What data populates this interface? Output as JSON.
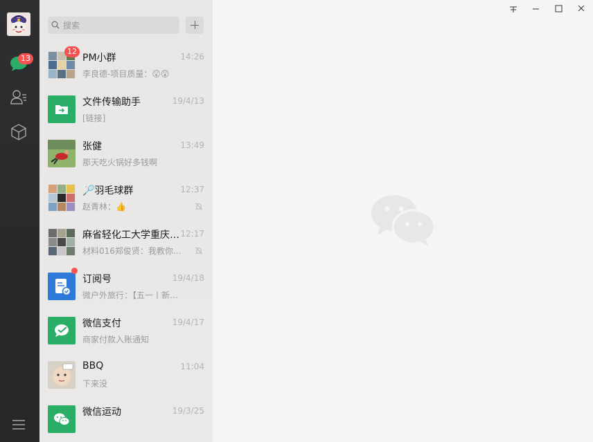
{
  "window": {
    "title": "WeChat"
  },
  "sidebar": {
    "chats_badge": "13",
    "icons": [
      "chat-icon",
      "contacts-icon",
      "mini-programs-icon",
      "menu-icon"
    ],
    "accent_color": "#2aae67"
  },
  "search": {
    "placeholder": "搜索"
  },
  "chats": [
    {
      "name": "PM小群",
      "preview": "李良德-项目质量：😲😲",
      "time": "14:26",
      "badge": "12"
    },
    {
      "name": "文件传输助手",
      "preview": "[链接]",
      "time": "19/4/13"
    },
    {
      "name": "张健",
      "preview": "那天吃火锅好多钱啊",
      "time": "13:49"
    },
    {
      "name": "🏸羽毛球群",
      "preview": "赵青林：👍",
      "time": "12:37",
      "muted": true
    },
    {
      "name": "麻省轻化工大学重庆…",
      "preview": "材料016郑俊贤：我教你…",
      "time": "12:17",
      "muted": true
    },
    {
      "name": "订阅号",
      "preview": "微户外旅行：【五一丨新…",
      "time": "19/4/18",
      "dot": true
    },
    {
      "name": "微信支付",
      "preview": "商家付款入账通知",
      "time": "19/4/17"
    },
    {
      "name": "BBQ",
      "preview": "下来没",
      "time": "11:04"
    },
    {
      "name": "微信运动",
      "preview": "",
      "time": "19/3/25"
    }
  ]
}
